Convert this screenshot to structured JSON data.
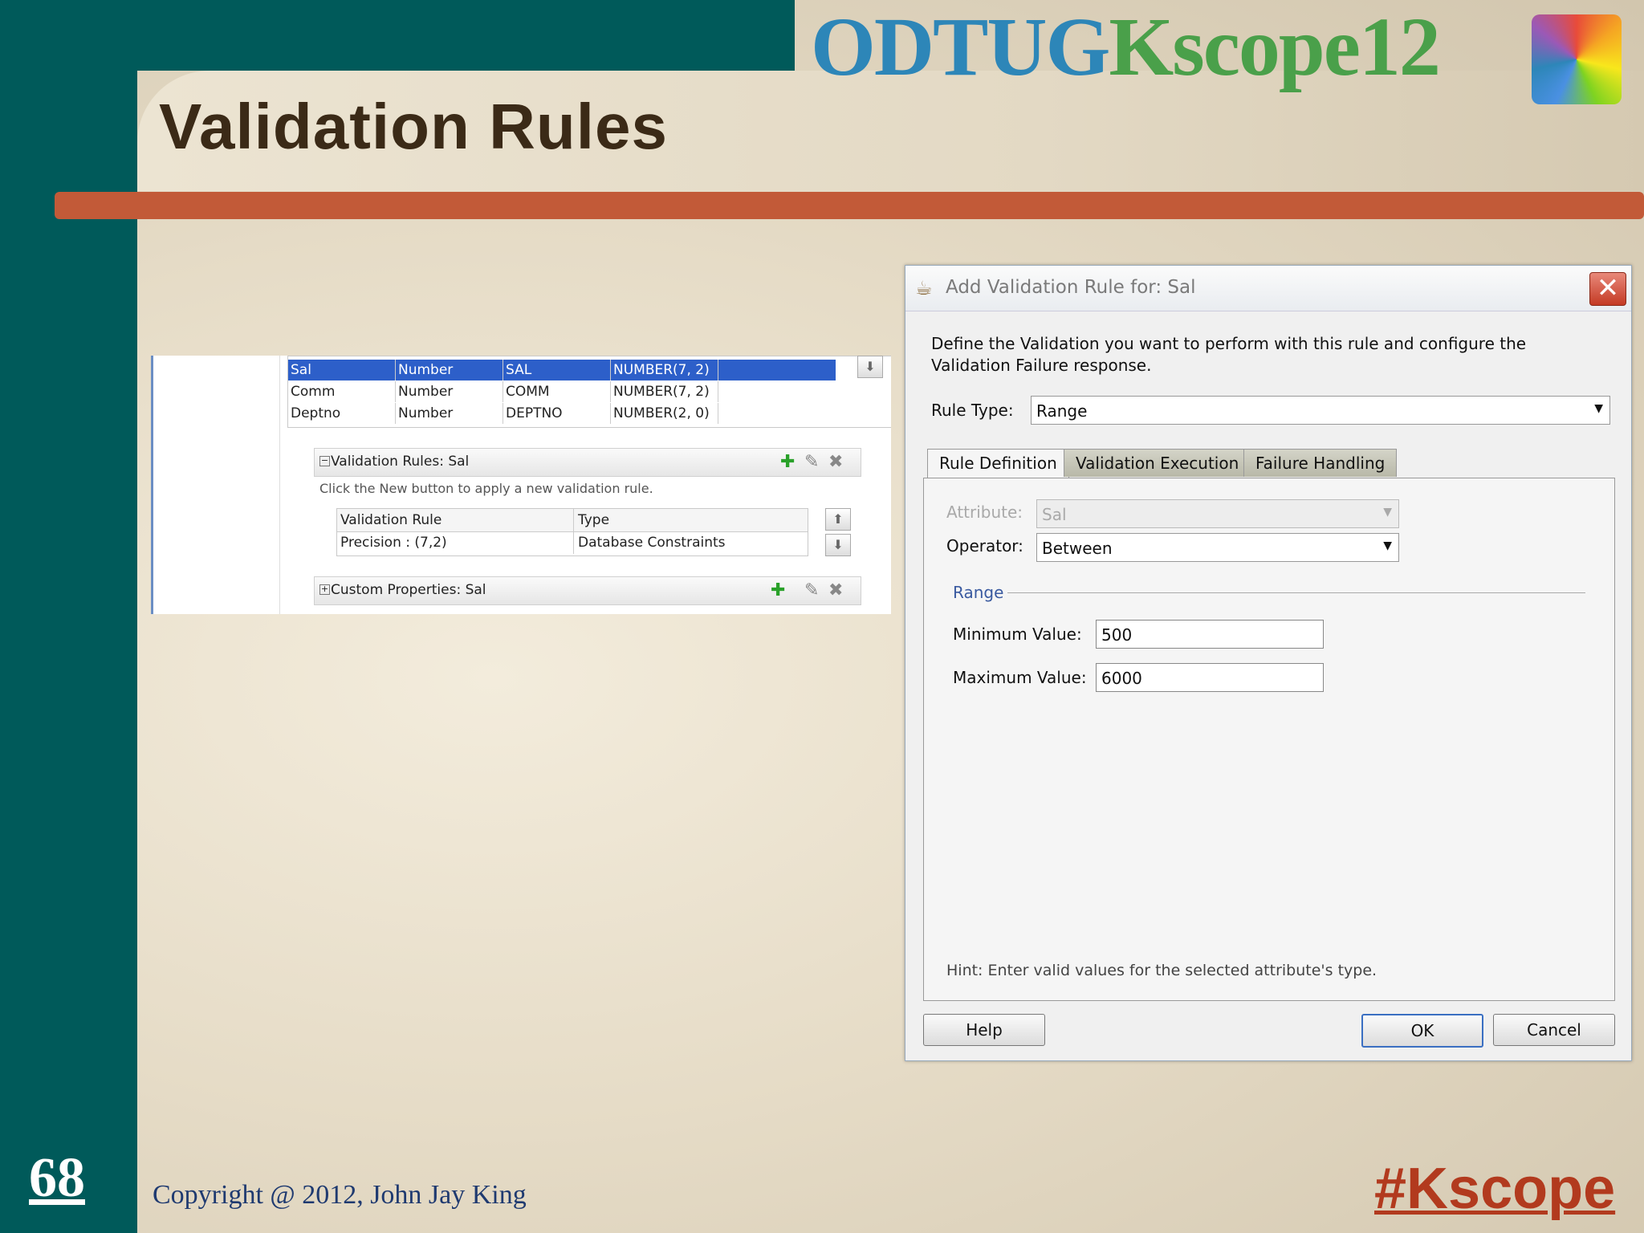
{
  "slide": {
    "logo_odtug": "ODTUG",
    "logo_kscope": "Kscope12",
    "title": "Validation Rules",
    "number": "68",
    "copyright": "Copyright @ 2012, John Jay King",
    "hashtag": "#Kscope"
  },
  "attributes_table": {
    "rows": [
      [
        "Sal",
        "Number",
        "SAL",
        "NUMBER(7, 2)"
      ],
      [
        "Comm",
        "Number",
        "COMM",
        "NUMBER(7, 2)"
      ],
      [
        "Deptno",
        "Number",
        "DEPTNO",
        "NUMBER(2, 0)"
      ]
    ]
  },
  "validation_section": {
    "header": "Validation Rules: Sal",
    "hint": "Click the New button to apply a new validation rule.",
    "columns": [
      "Validation Rule",
      "Type"
    ],
    "rows": [
      [
        "Precision : (7,2)",
        "Database Constraints"
      ]
    ]
  },
  "custom_props": {
    "header": "Custom Properties: Sal"
  },
  "dialog": {
    "title": "Add Validation Rule for: Sal",
    "description": "Define the Validation you want to perform with this rule and configure the Validation Failure response.",
    "rule_type_label": "Rule Type:",
    "rule_type_value": "Range",
    "tabs": [
      "Rule Definition",
      "Validation Execution",
      "Failure Handling"
    ],
    "attribute_label": "Attribute:",
    "attribute_value": "Sal",
    "operator_label": "Operator:",
    "operator_value": "Between",
    "range_legend": "Range",
    "min_label": "Minimum Value:",
    "min_value": "500",
    "max_label": "Maximum Value:",
    "max_value": "6000",
    "hint": "Hint: Enter valid values for the selected attribute's type.",
    "help": "Help",
    "ok": "OK",
    "cancel": "Cancel"
  },
  "colors": {
    "teal": "#005a5a",
    "accent_red": "#c25a38",
    "title_brown": "#3b2a17",
    "selection_blue": "#2d5fc9"
  }
}
